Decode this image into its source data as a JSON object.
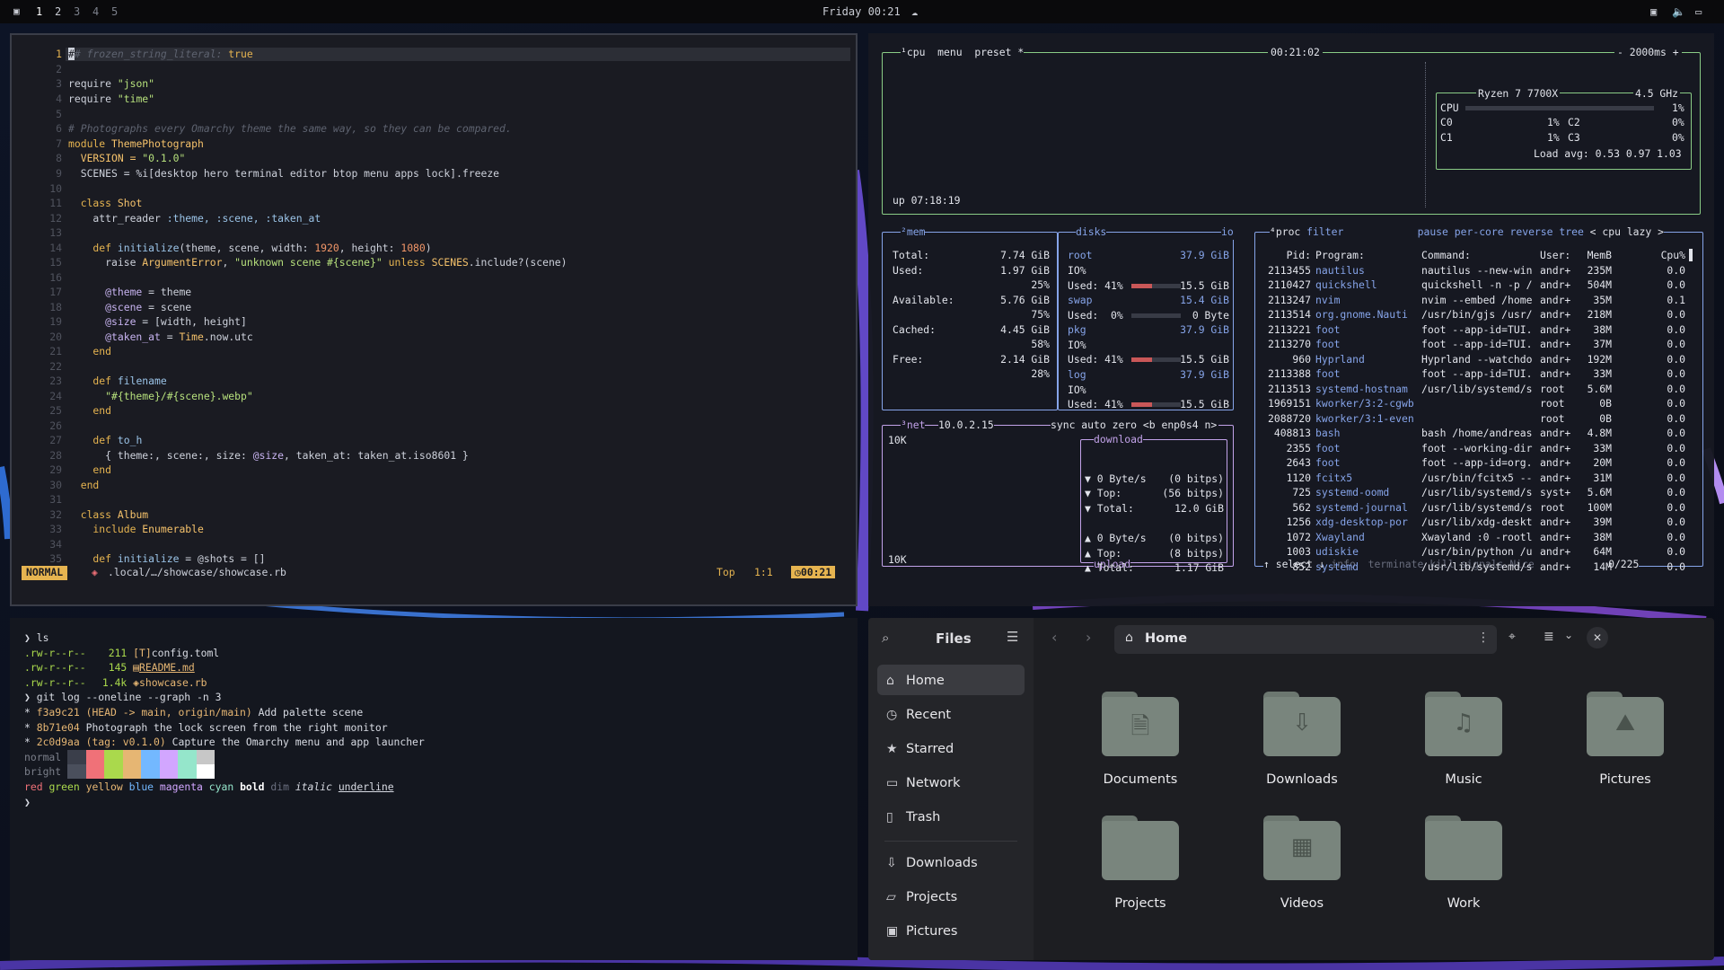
{
  "topbar": {
    "workspaces": [
      "1",
      "2",
      "3",
      "4",
      "5"
    ],
    "clock": "Friday 00:21"
  },
  "editor": {
    "line_numbers": [
      "1",
      "2",
      "3",
      "4",
      "5",
      "6",
      "7",
      "8",
      "9",
      "10",
      "11",
      "12",
      "13",
      "14",
      "15",
      "16",
      "17",
      "18",
      "19",
      "20",
      "21",
      "22",
      "23",
      "24",
      "25",
      "26",
      "27",
      "28",
      "29",
      "30",
      "31",
      "32",
      "33",
      "34",
      "35"
    ],
    "lines": {
      "l1_hl": "# frozen_string_literal:",
      "l1_v": " true",
      "l3a": "require ",
      "l3b": "\"json\"",
      "l4a": "require ",
      "l4b": "\"time\"",
      "l6": "# Photographs every Omarchy theme the same way, so they can be compared.",
      "l7a": "module ",
      "l7b": "ThemePhotograph",
      "l8a": "  VERSION = ",
      "l8b": "\"0.1.0\"",
      "l9": "  SCENES = %i[desktop hero terminal editor btop menu apps lock].freeze",
      "l11a": "  class ",
      "l11b": "Shot",
      "l12a": "    attr_reader ",
      "l12b": ":theme, :scene, :taken_at",
      "l14a": "    def ",
      "l14b": "initialize",
      "l14c": "(theme, scene, width: ",
      "l14d": "1920",
      ", height: ": "",
      "l14e": ", height: ",
      "l14f": "1080",
      "l14g": ")",
      "l15a": "      raise ",
      "l15b": "ArgumentError",
      ", ": "",
      "l15c": ", ",
      "l15d": "\"unknown scene #{scene}\"",
      "l15e": " unless ",
      "l15f": "SCENES",
      "l15g": ".include?(scene)",
      "l17a": "      @theme",
      " = theme": "",
      "l17b": " = theme",
      "l18a": "      @scene",
      "l18b": " = scene",
      "l19a": "      @size",
      "l19b": " = [width, height]",
      "l20a": "      @taken_at",
      "l20b": " = ",
      "l20c": "Time",
      ".now.utc": "",
      "l20d": ".now.utc",
      "l21": "    end",
      "l23a": "    def ",
      "l23b": "filename",
      "l24": "      \"#{theme}/#{scene}.webp\"",
      "l25": "    end",
      "l27a": "    def ",
      "l27b": "to_h",
      "l28a": "      { theme:, scene:, size: ",
      "l28b": "@size",
      ", taken_at: taken_at.iso8601 }": "",
      "l28c": ", taken_at: taken_at.iso8601 }",
      "l29": "    end",
      "l30": "  end",
      "l32a": "  class ",
      "l32b": "Album",
      "l33a": "    include ",
      "l33b": "Enumerable",
      "l35a": "    def ",
      "l35b": "initialize",
      " = @shots = []": "",
      "l35c": " = @shots = []"
    },
    "status": {
      "mode": "NORMAL",
      "path": ".local/…/showcase/showcase.rb",
      "pos": "Top",
      "cursor": "1:1",
      "time": "00:21"
    }
  },
  "btop": {
    "cpu": {
      "tab1": "¹cpu",
      "tab2": "menu",
      "tab3": "preset *",
      "time": "00:21:02",
      "interval": "- 2000ms +",
      "model": "Ryzen 7 7700X",
      "freq": "4.5 GHz",
      "cpu_label": "CPU",
      "cpu_pct": "1%",
      "c0": "C0",
      "c0p": "1%",
      "c1": "C1",
      "c1p": "1%",
      "c2": "C2",
      "c2p": "0%",
      "c3": "C3",
      "c3p": "0%",
      "load": "Load avg: 0.53 0.97 1.03",
      "uptime": "up 07:18:19"
    },
    "mem": {
      "title": "²mem",
      "total_l": "Total:",
      "total_v": "7.74 GiB",
      "used_l": "Used:",
      "used_v": "1.97 GiB",
      "used_p": "25%",
      "avail_l": "Available:",
      "avail_v": "5.76 GiB",
      "avail_p": "75%",
      "cached_l": "Cached:",
      "cached_v": "4.45 GiB",
      "cached_p": "58%",
      "free_l": "Free:",
      "free_v": "2.14 GiB",
      "free_p": "28%"
    },
    "disks": {
      "title": "disks",
      "io": "io",
      "d1": "root",
      "d1s": "37.9 GiB",
      "io1": "IO%",
      "u1": "Used: 41%",
      "u1v": "15.5 GiB",
      "d2": "swap",
      "d2s": "15.4 GiB",
      "u2": "Used:  0%",
      "u2v": "0 Byte",
      "d3": "pkg",
      "d3s": "37.9 GiB",
      "io3": "IO%",
      "u3": "Used: 41%",
      "u3v": "15.5 GiB",
      "d4": "log",
      "d4s": "37.9 GiB",
      "io4": "IO%",
      "u4": "Used: 41%",
      "u4v": "15.5 GiB"
    },
    "net": {
      "title": "³net",
      "ip": "10.0.2.15",
      "sync": "sync",
      "auto": "auto",
      "zero": "zero",
      "iface": "<b enp0s4 n>",
      "scale_top": "10K",
      "scale_bot": "10K",
      "download": "download",
      "dl_rate": "▼ 0 Byte/s",
      "dl_rate_b": "(0 bitps)",
      "dl_top": "▼ Top:",
      "dl_top_b": "(56 bitps)",
      "dl_total": "▼ Total:",
      "dl_total_v": "12.0 GiB",
      "ul_rate": "▲ 0 Byte/s",
      "ul_rate_b": "(0 bitps)",
      "ul_top": "▲ Top:",
      "ul_top_b": "(8 bitps)",
      "ul_total": "▲ Total:",
      "ul_total_v": "1.17 GiB",
      "upload": "upload"
    },
    "proc": {
      "title": "⁴proc",
      "filter": "filter",
      "pause": "pause",
      "percore": "per-core",
      "reverse": "reverse",
      "tree": "tree",
      "sort": "< cpu lazy >",
      "headers": {
        "pid": "Pid:",
        "prog": "Program:",
        "cmd": "Command:",
        "user": "User:",
        "mem": "MemB",
        "cpu": "Cpu%"
      },
      "rows": [
        {
          "pid": "2113455",
          "prog": "nautilus",
          "cmd": "nautilus --new-win",
          "user": "andr+",
          "mem": "235M",
          "cpu": "0.0"
        },
        {
          "pid": "2110427",
          "prog": "quickshell",
          "cmd": "quickshell -n -p /",
          "user": "andr+",
          "mem": "504M",
          "cpu": "0.0"
        },
        {
          "pid": "2113247",
          "prog": "nvim",
          "cmd": "nvim --embed /home",
          "user": "andr+",
          "mem": "35M",
          "cpu": "0.1"
        },
        {
          "pid": "2113514",
          "prog": "org.gnome.Nauti",
          "cmd": "/usr/bin/gjs /usr/",
          "user": "andr+",
          "mem": "218M",
          "cpu": "0.0"
        },
        {
          "pid": "2113221",
          "prog": "foot",
          "cmd": "foot --app-id=TUI.",
          "user": "andr+",
          "mem": "38M",
          "cpu": "0.0"
        },
        {
          "pid": "2113270",
          "prog": "foot",
          "cmd": "foot --app-id=TUI.",
          "user": "andr+",
          "mem": "37M",
          "cpu": "0.0"
        },
        {
          "pid": "960",
          "prog": "Hyprland",
          "cmd": "Hyprland --watchdo",
          "user": "andr+",
          "mem": "192M",
          "cpu": "0.0"
        },
        {
          "pid": "2113388",
          "prog": "foot",
          "cmd": "foot --app-id=TUI.",
          "user": "andr+",
          "mem": "33M",
          "cpu": "0.0"
        },
        {
          "pid": "2113513",
          "prog": "systemd-hostnam",
          "cmd": "/usr/lib/systemd/s",
          "user": "root",
          "mem": "5.6M",
          "cpu": "0.0"
        },
        {
          "pid": "1969151",
          "prog": "kworker/3:2-cgwb",
          "cmd": "",
          "user": "root",
          "mem": "0B",
          "cpu": "0.0"
        },
        {
          "pid": "2088720",
          "prog": "kworker/3:1-even",
          "cmd": "",
          "user": "root",
          "mem": "0B",
          "cpu": "0.0"
        },
        {
          "pid": "408813",
          "prog": "bash",
          "cmd": "bash /home/andreas",
          "user": "andr+",
          "mem": "4.8M",
          "cpu": "0.0"
        },
        {
          "pid": "2355",
          "prog": "foot",
          "cmd": "foot --working-dir",
          "user": "andr+",
          "mem": "33M",
          "cpu": "0.0"
        },
        {
          "pid": "2643",
          "prog": "foot",
          "cmd": "foot --app-id=org.",
          "user": "andr+",
          "mem": "20M",
          "cpu": "0.0"
        },
        {
          "pid": "1120",
          "prog": "fcitx5",
          "cmd": "/usr/bin/fcitx5 --",
          "user": "andr+",
          "mem": "31M",
          "cpu": "0.0"
        },
        {
          "pid": "725",
          "prog": "systemd-oomd",
          "cmd": "/usr/lib/systemd/s",
          "user": "syst+",
          "mem": "5.6M",
          "cpu": "0.0"
        },
        {
          "pid": "562",
          "prog": "systemd-journal",
          "cmd": "/usr/lib/systemd/s",
          "user": "root",
          "mem": "100M",
          "cpu": "0.0"
        },
        {
          "pid": "1256",
          "prog": "xdg-desktop-por",
          "cmd": "/usr/lib/xdg-deskt",
          "user": "andr+",
          "mem": "39M",
          "cpu": "0.0"
        },
        {
          "pid": "1072",
          "prog": "Xwayland",
          "cmd": "Xwayland :0 -rootl",
          "user": "andr+",
          "mem": "38M",
          "cpu": "0.0"
        },
        {
          "pid": "1003",
          "prog": "udiskie",
          "cmd": "/usr/bin/python /u",
          "user": "andr+",
          "mem": "64M",
          "cpu": "0.0"
        },
        {
          "pid": "852",
          "prog": "systemd",
          "cmd": "/usr/lib/systemd/s",
          "user": "andr+",
          "mem": "14M",
          "cpu": "0.0"
        }
      ],
      "footer": {
        "select": "↑ select ↓",
        "info": "info",
        "terminate": "terminate",
        "kill": "kill",
        "signals": "signals",
        "nice": "Nice",
        "count": "0/225"
      }
    }
  },
  "terminal": {
    "l1": "❯ ls",
    "files": [
      {
        "perm": ".rw-r--r--",
        "size": "211",
        "icon": "[T]",
        "name": "config.toml"
      },
      {
        "perm": ".rw-r--r--",
        "size": "145",
        "icon": "▤",
        "name": "README.md"
      },
      {
        "perm": ".rw-r--r--",
        "size": "1.4k",
        "icon": "◈",
        "name": "showcase.rb"
      }
    ],
    "l5": "❯ git log --oneline --graph -n 3",
    "commits": [
      {
        "hash": "f3a9c21",
        "ref": "(HEAD -> main, origin/main)",
        "msg": "Add palette scene"
      },
      {
        "hash": "8b71e04",
        "ref": "",
        "msg": "Photograph the lock screen from the right monitor"
      },
      {
        "hash": "2c0d9aa",
        "ref": "(tag: v0.1.0)",
        "msg": "Capture the Omarchy menu and app launcher"
      }
    ],
    "normal": "normal",
    "bright": "bright",
    "styles": {
      "red": "red",
      "green": "green",
      "yellow": "yellow",
      "blue": "blue",
      "magenta": "magenta",
      "cyan": "cyan",
      "bold": "bold",
      "dim": "dim",
      "italic": "italic",
      "underline": "underline"
    },
    "prompt": "❯",
    "colors": {
      "normal": [
        "#3a3e4a",
        "#f07178",
        "#aad94c",
        "#e6b673",
        "#73b8ff",
        "#d2a6ff",
        "#95e6cb",
        "#c7c7c7"
      ],
      "bright": [
        "#4a4f5c",
        "#f07178",
        "#aad94c",
        "#e6b673",
        "#73b8ff",
        "#d2a6ff",
        "#95e6cb",
        "#ffffff"
      ]
    }
  },
  "files": {
    "title": "Files",
    "location": "Home",
    "sidebar": [
      {
        "icon": "home-icon",
        "label": "Home"
      },
      {
        "icon": "recent-icon",
        "label": "Recent"
      },
      {
        "icon": "star-icon",
        "label": "Starred"
      },
      {
        "icon": "network-icon",
        "label": "Network"
      },
      {
        "icon": "trash-icon",
        "label": "Trash"
      },
      {
        "icon": "download-icon",
        "label": "Downloads"
      },
      {
        "icon": "folder-icon",
        "label": "Projects"
      },
      {
        "icon": "pictures-icon",
        "label": "Pictures"
      }
    ],
    "folders": [
      {
        "name": "Documents",
        "icon": "document-icon"
      },
      {
        "name": "Downloads",
        "icon": "download-icon"
      },
      {
        "name": "Music",
        "icon": "music-icon"
      },
      {
        "name": "Pictures",
        "icon": "image-icon"
      },
      {
        "name": "Projects",
        "icon": ""
      },
      {
        "name": "Videos",
        "icon": "video-icon"
      },
      {
        "name": "Work",
        "icon": ""
      }
    ]
  },
  "colors": {
    "accent_green": "#8fd38a",
    "accent_blue": "#8aa9f0",
    "status_yellow": "#e6b450"
  }
}
